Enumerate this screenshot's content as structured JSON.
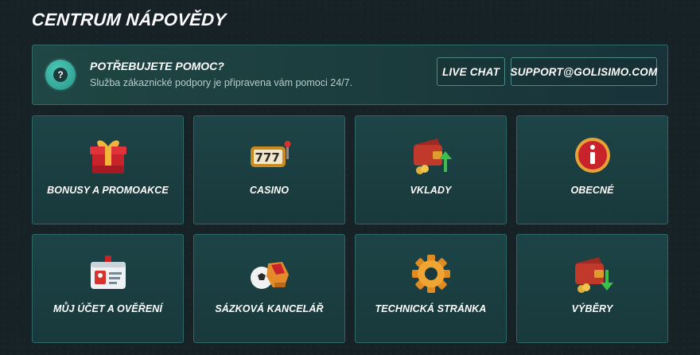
{
  "header": {
    "title": "CENTRUM NÁPOVĚDY"
  },
  "help_banner": {
    "title": "POTŘEBUJETE POMOC?",
    "subtitle": "Služba zákaznické podpory je připravena vám pomoci 24/7.",
    "live_chat_label": "LIVE CHAT",
    "email_label": "SUPPORT@GOLISIMO.COM"
  },
  "categories": [
    {
      "label": "BONUSY A PROMOAKCE",
      "icon": "gift-icon"
    },
    {
      "label": "CASINO",
      "icon": "slot-machine-icon"
    },
    {
      "label": "VKLADY",
      "icon": "wallet-deposit-icon"
    },
    {
      "label": "OBECNÉ",
      "icon": "info-icon"
    },
    {
      "label": "MŮJ ÚČET A OVĚŘENÍ",
      "icon": "id-card-icon"
    },
    {
      "label": "SÁZKOVÁ KANCELÁŘ",
      "icon": "football-glove-icon"
    },
    {
      "label": "TECHNICKÁ STRÁNKA",
      "icon": "gear-icon"
    },
    {
      "label": "VÝBĚRY",
      "icon": "wallet-withdraw-icon"
    }
  ],
  "colors": {
    "background": "#172226",
    "card": "#1c4446",
    "border": "#2d6664",
    "accent": "#3fb6a6"
  }
}
